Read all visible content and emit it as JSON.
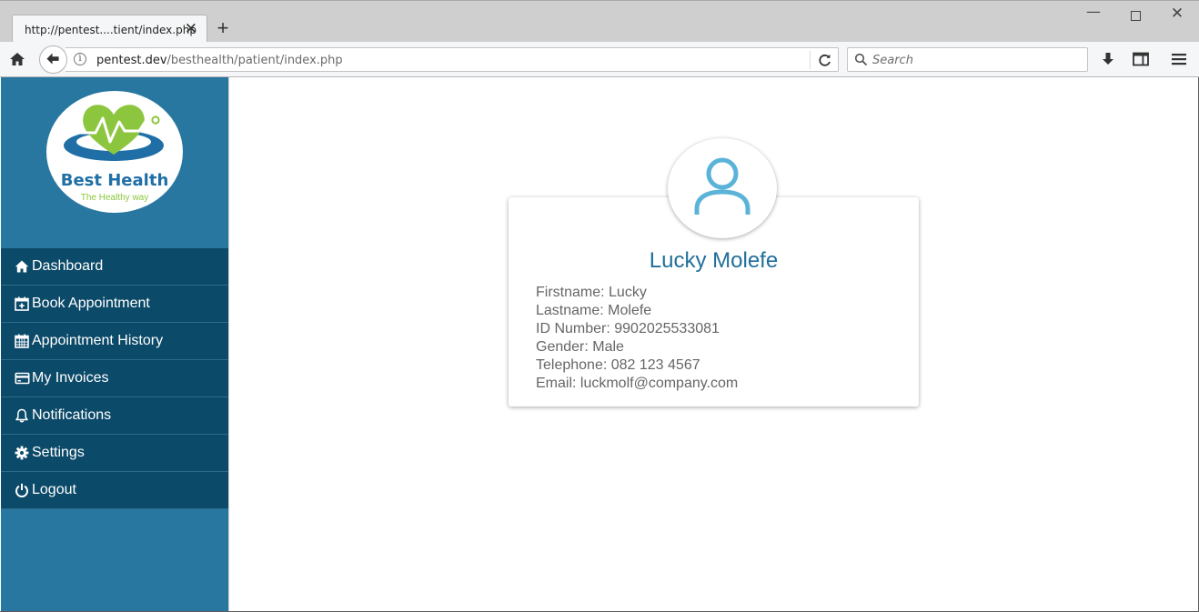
{
  "browser": {
    "tab_title": "http://pentest....tient/index.php",
    "tab_close": "✕",
    "new_tab": "+",
    "url_host": "pentest.dev",
    "url_path": "/besthealth/patient/index.php",
    "search_placeholder": "Search"
  },
  "logo": {
    "name": "Best Health",
    "tagline": "The Healthy way"
  },
  "sidebar": {
    "items": [
      {
        "label": "Dashboard",
        "icon": "home-icon"
      },
      {
        "label": "Book Appointment",
        "icon": "calendar-plus-icon"
      },
      {
        "label": "Appointment History",
        "icon": "calendar-icon"
      },
      {
        "label": "My Invoices",
        "icon": "credit-card-icon"
      },
      {
        "label": "Notifications",
        "icon": "bell-icon"
      },
      {
        "label": "Settings",
        "icon": "gear-icon"
      },
      {
        "label": "Logout",
        "icon": "power-icon"
      }
    ]
  },
  "profile": {
    "name": "Lucky Molefe",
    "firstname": "Firstname: Lucky",
    "lastname": "Lastname: Molefe",
    "id_number": "ID Number: 9902025533081",
    "gender": "Gender: Male",
    "telephone": "Telephone: 082 123 4567",
    "email": "Email: luckmolf@company.com"
  },
  "colors": {
    "sidebar_bg": "#2877a0",
    "menu_bg": "#0c4a69",
    "name_color": "#216f9c",
    "avatar_icon": "#5bb4d8",
    "logo_green": "#8cc63e",
    "logo_blue": "#1f6fa6"
  }
}
